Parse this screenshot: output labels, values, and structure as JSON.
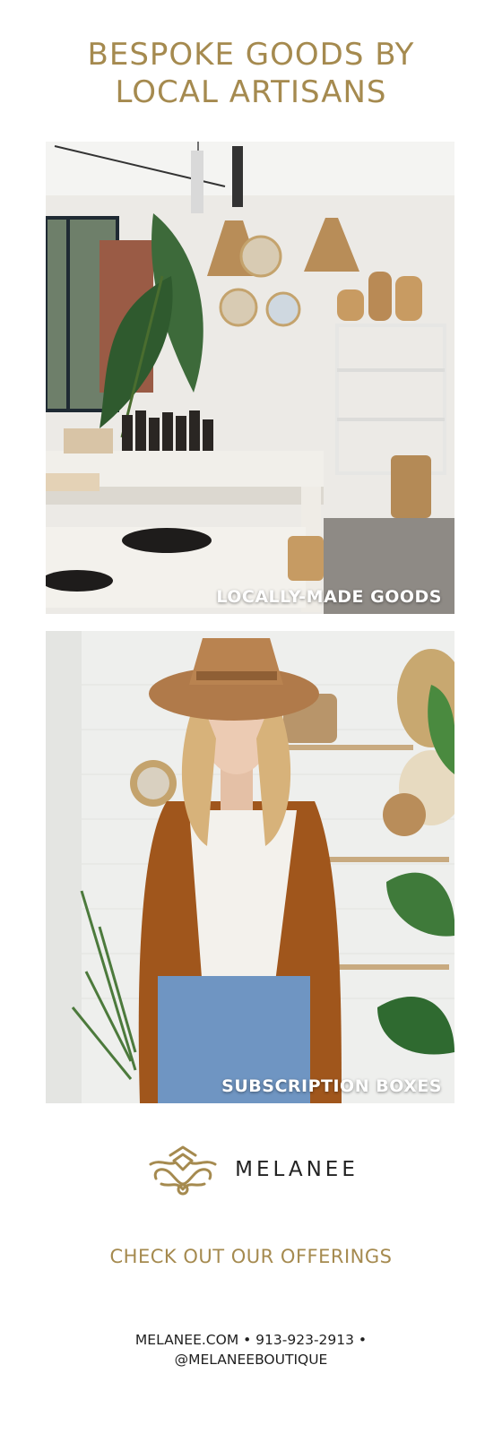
{
  "headline": {
    "line1": "BESPOKE GOODS BY",
    "line2": "LOCAL ARTISANS"
  },
  "photos": [
    {
      "caption": "LOCALLY-MADE GOODS",
      "subject": "boutique interior with tables of candles, bottles, woven baskets and hanging rattan lamps"
    },
    {
      "caption": "SUBSCRIPTION BOXES",
      "subject": "woman in wide-brim hat and fringed suede jacket in front of plant-filled shelves"
    }
  ],
  "brand": {
    "name": "MELANEE",
    "logo_icon": "ornamental-crest-icon"
  },
  "cta": "CHECK OUT OUR OFFERINGS",
  "contact": {
    "line1": "MELANEE.COM • 913-923-2913 •",
    "line2": "@MELANEEBOUTIQUE"
  },
  "colors": {
    "accent": "#a58a4f",
    "text": "#1f1f1f",
    "background": "#ffffff"
  }
}
